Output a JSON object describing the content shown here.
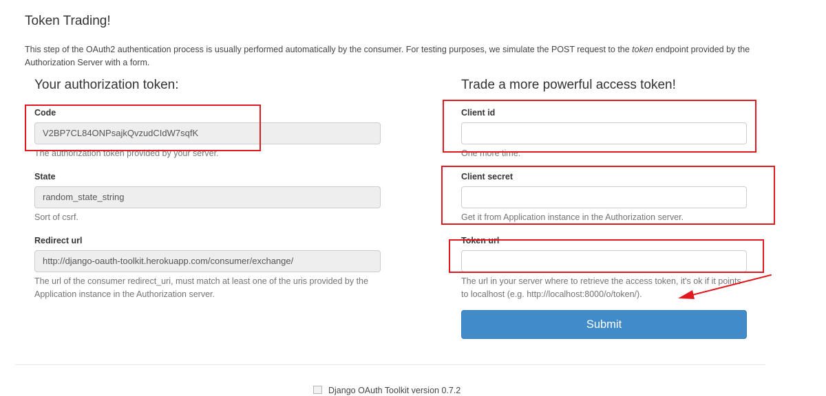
{
  "page": {
    "title": "Token Trading!",
    "intro_before": "This step of the OAuth2 authentication process is usually performed automatically by the consumer. For testing purposes, we simulate the POST request to the ",
    "intro_em": "token",
    "intro_after": " endpoint provided by the Authorization Server with a form."
  },
  "left": {
    "title": "Your authorization token:",
    "code": {
      "label": "Code",
      "value": "V2BP7CL84ONPsajkQvzudCIdW7sqfK",
      "help": "The authorization token provided by your server."
    },
    "state": {
      "label": "State",
      "value": "random_state_string",
      "help": "Sort of csrf."
    },
    "redirect": {
      "label": "Redirect url",
      "value": "http://django-oauth-toolkit.herokuapp.com/consumer/exchange/",
      "help": "The url of the consumer redirect_uri, must match at least one of the uris provided by the Application instance in the Authorization server."
    }
  },
  "right": {
    "title": "Trade a more powerful access token!",
    "client_id": {
      "label": "Client id",
      "value": "",
      "help": "One more time."
    },
    "client_secret": {
      "label": "Client secret",
      "value": "",
      "help": "Get it from Application instance in the Authorization server."
    },
    "token_url": {
      "label": "Token url",
      "value": "",
      "help": "The url in your server where to retrieve the access token, it's ok if it points to localhost (e.g. http://localhost:8000/o/token/)."
    },
    "submit_label": "Submit"
  },
  "footer": {
    "text": "Django OAuth Toolkit version 0.7.2"
  },
  "colors": {
    "primary": "#428bca",
    "annotation_red": "#e0191f",
    "readonly_bg": "#eeeeee"
  }
}
